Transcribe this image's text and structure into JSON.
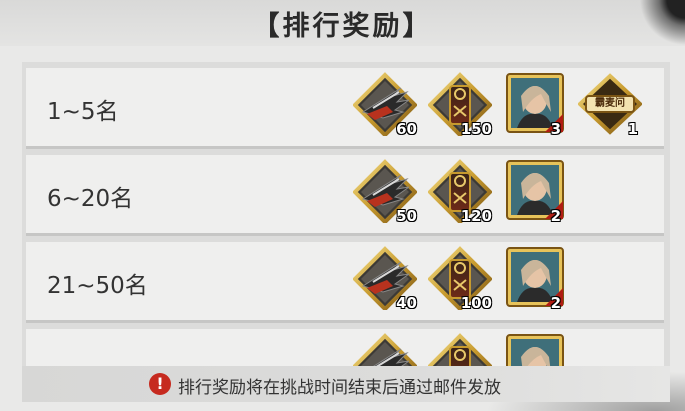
{
  "page_title": "【排行奖励】",
  "rows": [
    {
      "rank": "1~5名",
      "rewards": [
        {
          "icon": "claw-weapon-icon",
          "count": "60"
        },
        {
          "icon": "scroll-token-icon",
          "count": "150"
        },
        {
          "icon": "character-portrait-icon",
          "count": "3"
        },
        {
          "icon": "title-badge-icon",
          "count": "1",
          "badge_text": "霸麦问"
        }
      ]
    },
    {
      "rank": "6~20名",
      "rewards": [
        {
          "icon": "claw-weapon-icon",
          "count": "50"
        },
        {
          "icon": "scroll-token-icon",
          "count": "120"
        },
        {
          "icon": "character-portrait-icon",
          "count": "2"
        }
      ]
    },
    {
      "rank": "21~50名",
      "rewards": [
        {
          "icon": "claw-weapon-icon",
          "count": "40"
        },
        {
          "icon": "scroll-token-icon",
          "count": "100"
        },
        {
          "icon": "character-portrait-icon",
          "count": "2"
        }
      ]
    }
  ],
  "notice": {
    "icon": "warning-icon",
    "text": "排行奖励将在挑战时间结束后通过邮件发放"
  }
}
